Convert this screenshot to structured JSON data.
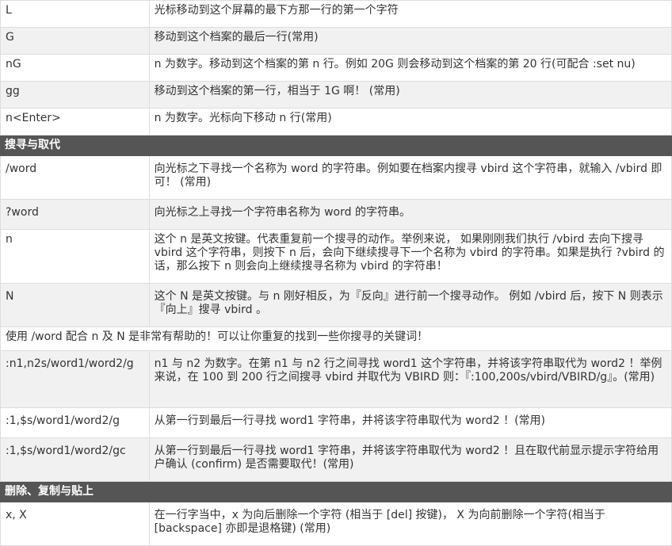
{
  "rows": [
    {
      "key": "L",
      "desc": "光标移动到这个屏幕的最下方那一行的第一个字符"
    },
    {
      "key": "G",
      "desc": "移动到这个档案的最后一行(常用)"
    },
    {
      "key": "nG",
      "desc": "n 为数字。移动到这个档案的第 n 行。例如 20G 则会移动到这个档案的第 20 行(可配合 :set nu)"
    },
    {
      "key": "gg",
      "desc": "移动到这个档案的第一行，相当于 1G 啊！ (常用)"
    },
    {
      "key": "n<Enter>",
      "desc": "n 为数字。光标向下移动 n 行(常用)"
    }
  ],
  "section_search": {
    "title": "搜寻与取代"
  },
  "search_rows": [
    {
      "key": "/word",
      "desc": "向光标之下寻找一个名称为 word 的字符串。例如要在档案内搜寻 vbird 这个字符串，就输入 /vbird 即可！ (常用)"
    },
    {
      "key": "?word",
      "desc": "向光标之上寻找一个字符串名称为 word 的字符串。"
    },
    {
      "key": "n",
      "desc": "这个 n 是英文按键。代表重复前一个搜寻的动作。举例来说， 如果刚刚我们执行 /vbird 去向下搜寻 vbird 这个字符串，则按下 n 后，会向下继续搜寻下一个名称为 vbird 的字符串。如果是执行 ?vbird 的话，那么按下 n 则会向上继续搜寻名称为 vbird 的字符串！"
    },
    {
      "key": "N",
      "desc": "这个 N 是英文按键。与 n 刚好相反，为『反向』进行前一个搜寻动作。 例如 /vbird 后，按下 N 则表示『向上』搜寻 vbird 。"
    }
  ],
  "note": "使用 /word 配合 n 及 N 是非常有帮助的！可以让你重复的找到一些你搜寻的关键词！",
  "replace_rows": [
    {
      "key": ":n1,n2s/word1/word2/g",
      "desc": "n1 与 n2 为数字。在第 n1 与 n2 行之间寻找 word1 这个字符串，并将该字符串取代为 word2 ！举例来说，在 100 到 200 行之间搜寻 vbird 并取代为 VBIRD 则：『:100,200s/vbird/VBIRD/g』。(常用)"
    },
    {
      "key": ":1,$s/word1/word2/g",
      "desc": "从第一行到最后一行寻找 word1 字符串，并将该字符串取代为 word2 ！(常用)"
    },
    {
      "key": ":1,$s/word1/word2/gc",
      "desc": "从第一行到最后一行寻找 word1 字符串，并将该字符串取代为 word2 ！且在取代前显示提示字符给用户确认 (confirm) 是否需要取代！(常用)"
    }
  ],
  "section_delete": {
    "title": "删除、复制与贴上"
  },
  "delete_rows": [
    {
      "key": "x, X",
      "desc": "在一行字当中，x 为向后删除一个字符 (相当于 [del] 按键)， X 为向前删除一个字符(相当于 [backspace] 亦即是退格键) (常用)"
    }
  ]
}
